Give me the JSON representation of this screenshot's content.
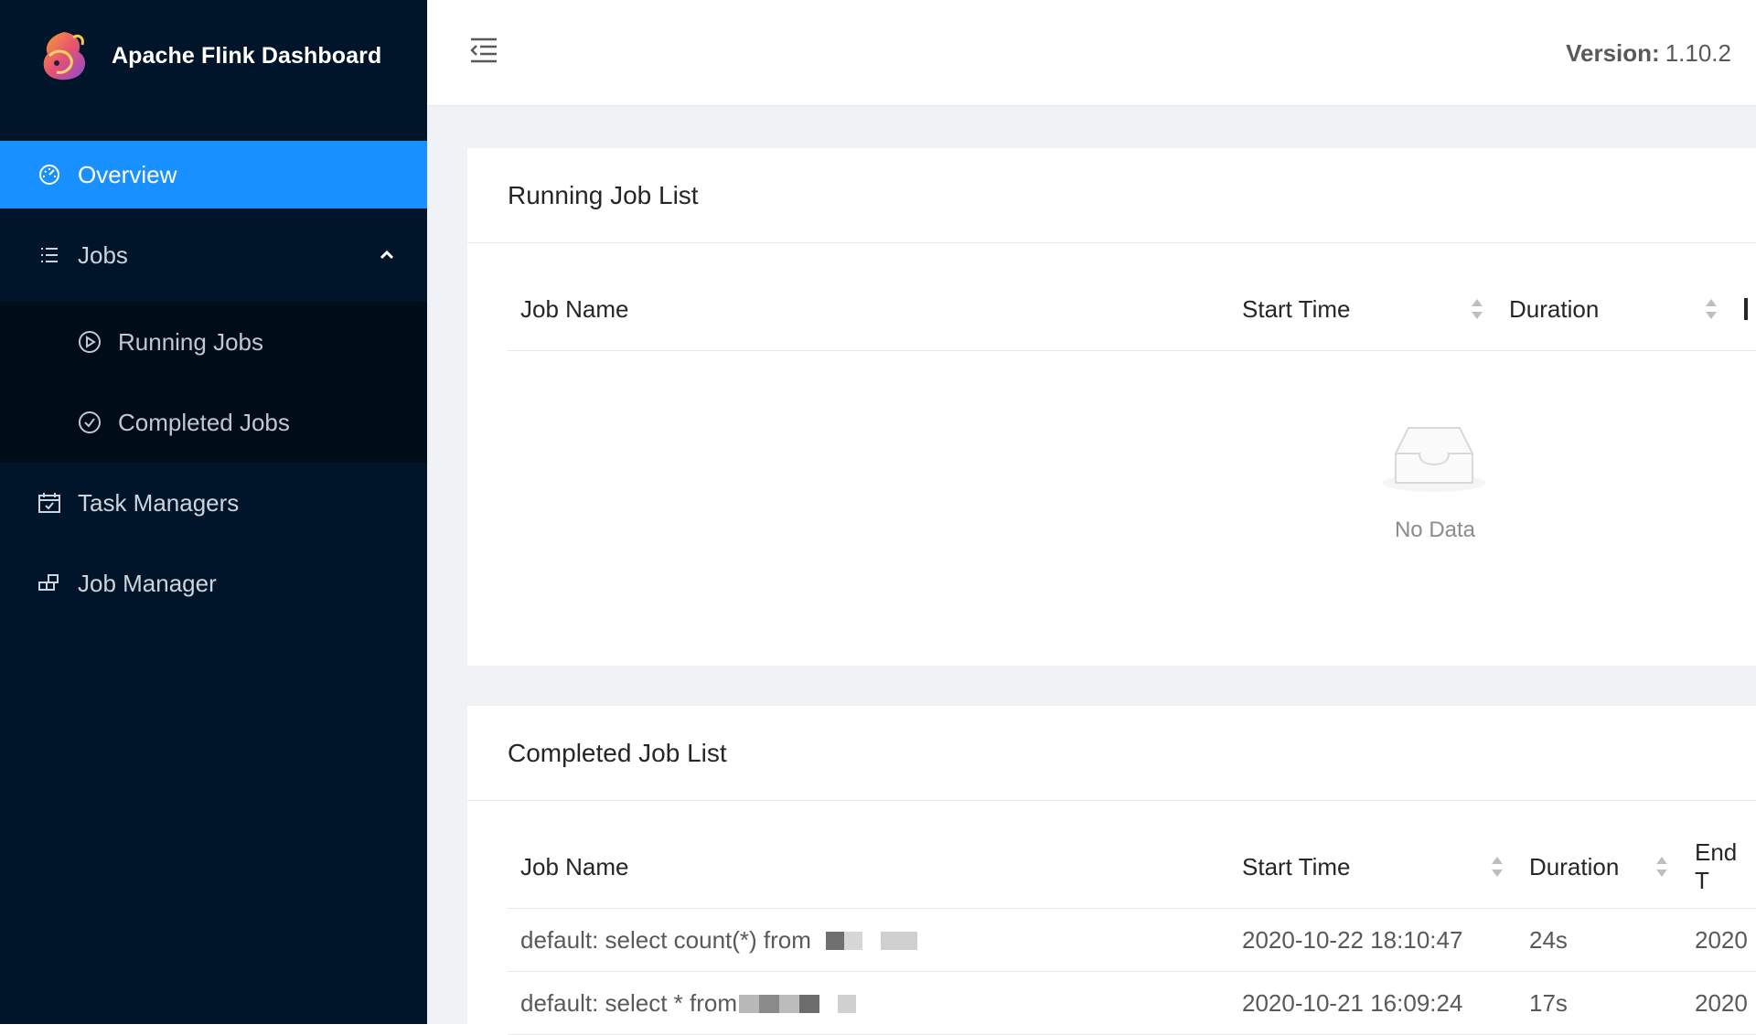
{
  "brand": {
    "title": "Apache Flink Dashboard",
    "logo_icon": "flink-squirrel-logo"
  },
  "sidebar": {
    "items": [
      {
        "label": "Overview",
        "icon": "dashboard-icon",
        "active": true
      },
      {
        "label": "Jobs",
        "icon": "list-icon",
        "expanded": true,
        "children": [
          {
            "label": "Running Jobs",
            "icon": "play-circle-icon"
          },
          {
            "label": "Completed Jobs",
            "icon": "check-circle-icon"
          }
        ]
      },
      {
        "label": "Task Managers",
        "icon": "schedule-icon"
      },
      {
        "label": "Job Manager",
        "icon": "build-icon"
      }
    ]
  },
  "header": {
    "version_label": "Version:",
    "version_value": "1.10.2"
  },
  "running": {
    "title": "Running Job List",
    "columns": [
      "Job Name",
      "Start Time",
      "Duration"
    ],
    "empty_text": "No Data"
  },
  "completed": {
    "title": "Completed Job List",
    "columns": [
      "Job Name",
      "Start Time",
      "Duration",
      "End T"
    ],
    "rows": [
      {
        "name": "default: select count(*) from",
        "start": "2020-10-22 18:10:47",
        "duration": "24s",
        "end": "2020"
      },
      {
        "name": "default: select * from",
        "start": "2020-10-21 16:09:24",
        "duration": "17s",
        "end": "2020"
      }
    ]
  },
  "colors": {
    "sidebar_bg": "#001529",
    "submenu_bg": "#000c17",
    "accent": "#1890ff",
    "content_bg": "#f0f2f5"
  }
}
